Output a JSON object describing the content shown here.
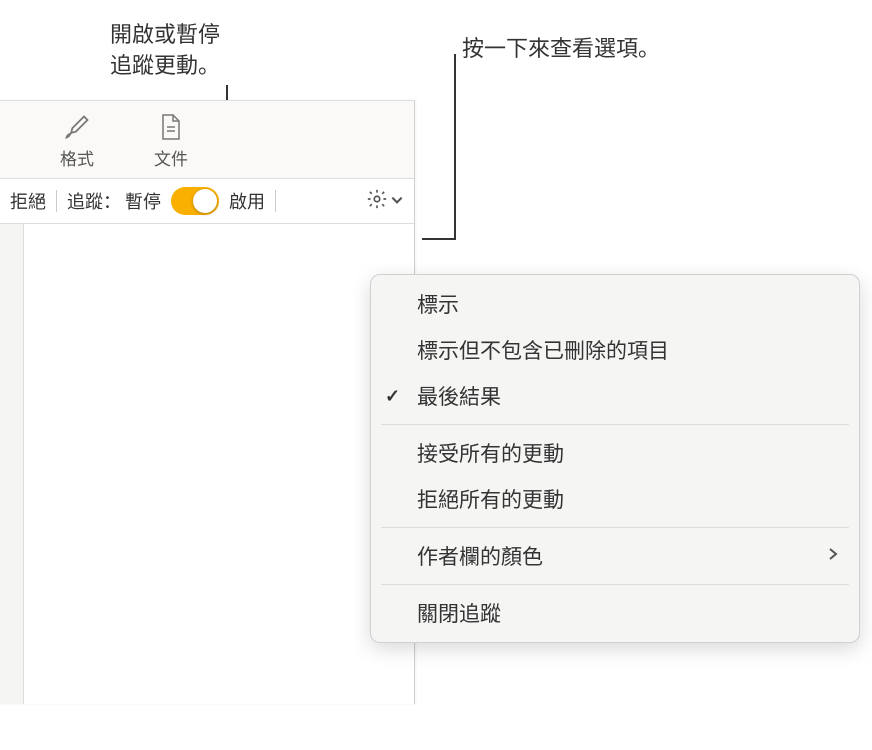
{
  "callouts": {
    "toggle": "開啟或暫停\n追蹤更動。",
    "options": "按一下來查看選項。"
  },
  "toolbar": {
    "format_label": "格式",
    "document_label": "文件"
  },
  "subtoolbar": {
    "reject_label": "拒絕",
    "tracking_prefix": "追蹤：",
    "paused_label": "暫停",
    "enabled_label": "啟用"
  },
  "menu": {
    "markup": "標示",
    "markup_no_deletions": "標示但不包含已刪除的項目",
    "final": "最後結果",
    "accept_all": "接受所有的更動",
    "reject_all": "拒絕所有的更動",
    "author_color": "作者欄的顏色",
    "turn_off": "關閉追蹤"
  }
}
